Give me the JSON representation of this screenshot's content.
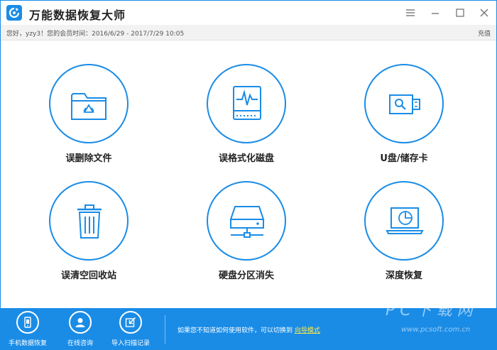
{
  "app": {
    "title": "万能数据恢复大师"
  },
  "infobar": {
    "greeting": "您好，yzy3！您的会员时间：2016/6/29 - 2017/7/29 10:05",
    "recharge": "充值"
  },
  "tiles": [
    {
      "label": "误删除文件",
      "icon": "folder-recycle-icon"
    },
    {
      "label": "误格式化磁盘",
      "icon": "disk-pulse-icon"
    },
    {
      "label": "U盘/储存卡",
      "icon": "usb-drive-icon"
    },
    {
      "label": "误清空回收站",
      "icon": "trash-bin-icon"
    },
    {
      "label": "硬盘分区消失",
      "icon": "network-drive-icon"
    },
    {
      "label": "深度恢复",
      "icon": "laptop-scan-icon"
    }
  ],
  "bottombar": {
    "items": [
      {
        "label": "手机数据恢复",
        "icon": "phone-icon"
      },
      {
        "label": "在线咨询",
        "icon": "user-support-icon"
      },
      {
        "label": "导入扫描记录",
        "icon": "import-icon"
      }
    ],
    "hint_text": "如果您不知道如何使用软件，可以切换到",
    "hint_link": "向导模式"
  },
  "watermark": {
    "main": "PC下载网",
    "url": "www.pcsoft.com.cn"
  },
  "colors": {
    "accent": "#1a8ce6",
    "link": "#ffe94a"
  }
}
